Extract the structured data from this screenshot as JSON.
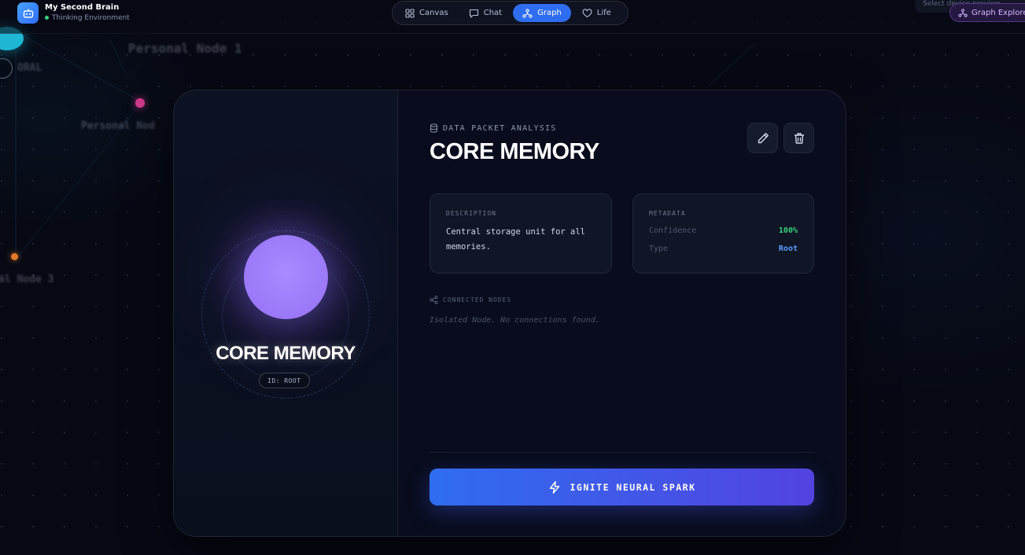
{
  "app": {
    "title": "My Second Brain",
    "status": "Thinking Environment",
    "status_color": "#34d17a",
    "logo_icon": "robot-icon"
  },
  "nav": {
    "tabs": [
      {
        "label": "Canvas",
        "icon": "grid-icon",
        "active": false
      },
      {
        "label": "Chat",
        "icon": "chat-bubble-icon",
        "active": false
      },
      {
        "label": "Graph",
        "icon": "network-icon",
        "active": true
      },
      {
        "label": "Life",
        "icon": "heart-icon",
        "active": false
      }
    ]
  },
  "top_right": {
    "device_hint": "Select device preview",
    "explorer_label": "Graph Explorer"
  },
  "graph_background": {
    "labels": [
      "Personal Node 1",
      "Personal Nod",
      "ORAL",
      "al Node 3"
    ]
  },
  "node": {
    "name": "CORE MEMORY",
    "id_badge": "ID: ROOT",
    "orb_color": "#9d7cfa",
    "kicker": "DATA PACKET ANALYSIS",
    "description_label": "DESCRIPTION",
    "description": "Central storage unit for all memories.",
    "metadata_label": "METADATA",
    "metadata": [
      {
        "key": "Confidence",
        "value": "100%",
        "color": "#34d17a"
      },
      {
        "key": "Type",
        "value": "Root",
        "color": "#5a9bff"
      }
    ],
    "connected_label": "CONNECTED NODES",
    "connected_empty": "Isolated Node. No connections found.",
    "action_label": "IGNITE NEURAL SPARK",
    "edit_icon": "pencil-icon",
    "delete_icon": "trash-icon"
  },
  "colors": {
    "accent": "#2f6df0",
    "background": "#060914"
  }
}
